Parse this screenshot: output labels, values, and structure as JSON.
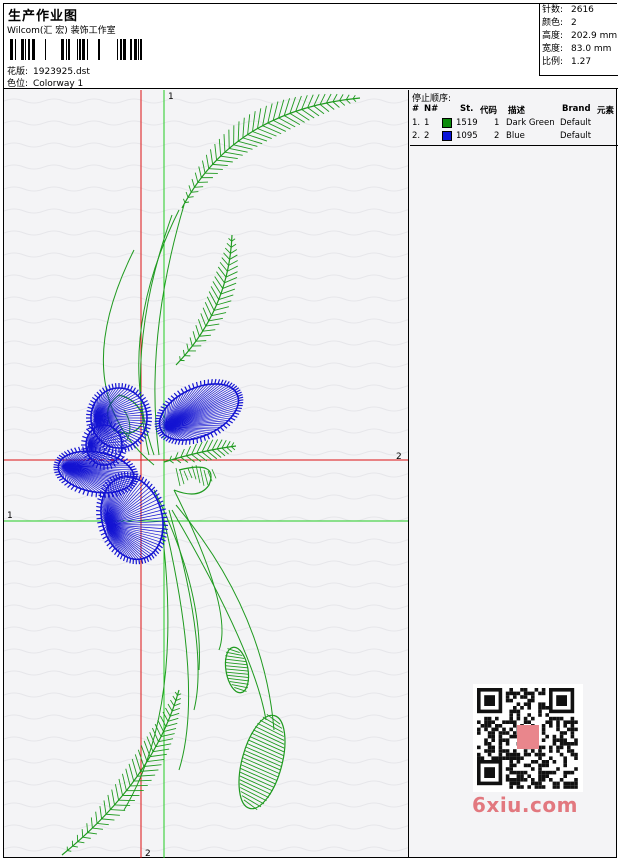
{
  "header": {
    "title": "生产作业图",
    "company": "Wilcom(汇 宏) 装饰工作室",
    "design_label": "花版:",
    "design_file": "1923925.dst",
    "colorway_label": "色位:",
    "colorway": "Colorway 1"
  },
  "stats": [
    {
      "label": "针数:",
      "value": "2616"
    },
    {
      "label": "颜色:",
      "value": "2"
    },
    {
      "label": "高度:",
      "value": "202.9 mm"
    },
    {
      "label": "宽度:",
      "value": "83.0 mm"
    },
    {
      "label": "比例:",
      "value": "1.27"
    }
  ],
  "stop_sequence": {
    "title": "停止顺序:",
    "headers": {
      "num": "#",
      "n": "N#",
      "st": "St.",
      "code": "代码",
      "desc": "描述",
      "brand": "Brand",
      "elem": "元素"
    },
    "rows": [
      {
        "num": "1.",
        "n": "1",
        "color": "#0a8a0a",
        "st": "1519",
        "code": "1",
        "desc": "Dark Green",
        "brand": "Default"
      },
      {
        "num": "2.",
        "n": "2",
        "color": "#0a14d8",
        "st": "1095",
        "code": "2",
        "desc": "Blue",
        "brand": "Default"
      }
    ]
  },
  "guides": {
    "v1": "1",
    "h1": "1",
    "v2": "2",
    "h2": "2"
  },
  "watermark": "6xiu.com",
  "colors": {
    "green_thread": "#1f9a1f",
    "blue_thread": "#1414d2",
    "guide_green": "#22cc22",
    "guide_red": "#dd1111"
  }
}
